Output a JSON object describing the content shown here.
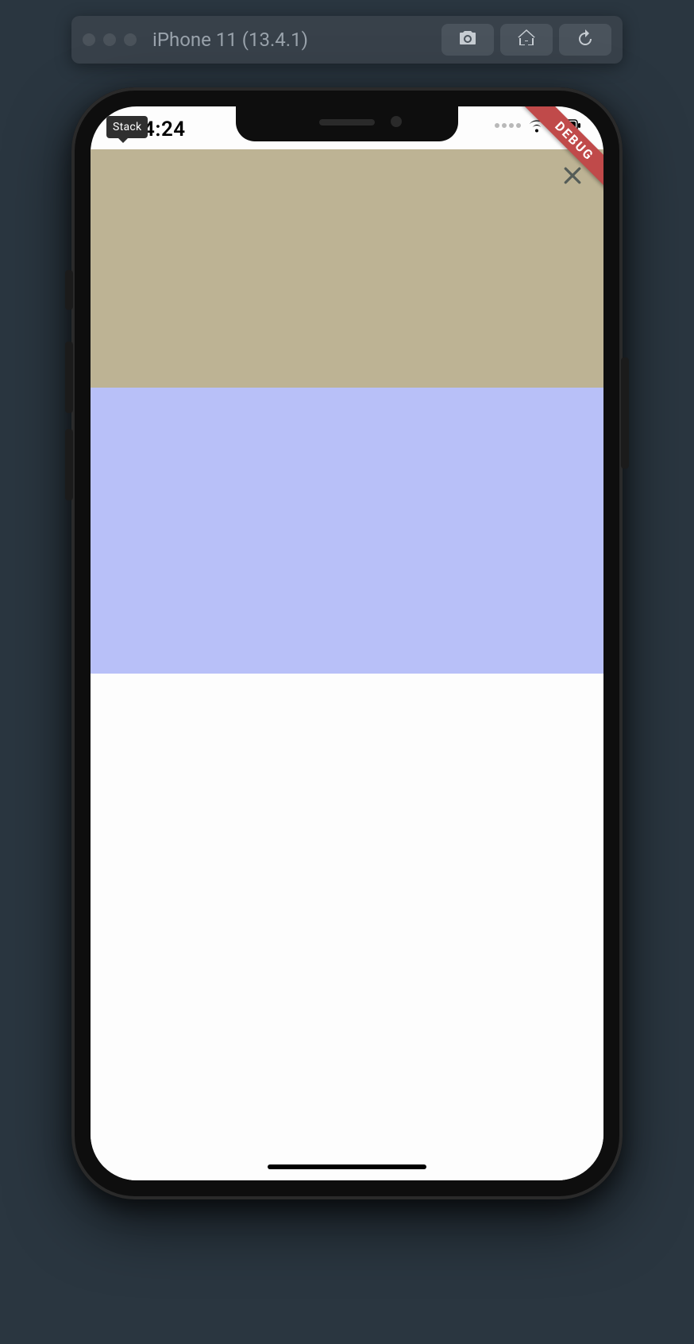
{
  "window": {
    "title": "iPhone 11 (13.4.1)"
  },
  "toolbar": {
    "screenshot_tooltip": "Screenshot",
    "home_tooltip": "Home",
    "rotate_tooltip": "Rotate"
  },
  "status": {
    "time": "4:24",
    "stack_chip": "Stack"
  },
  "banner": {
    "debug_label": "DEBUG"
  },
  "colors": {
    "block_top": "#bdb394",
    "block_mid": "#b8c0f8",
    "block_bottom": "#fdfdfd",
    "debug_banner": "#c04a4a"
  }
}
